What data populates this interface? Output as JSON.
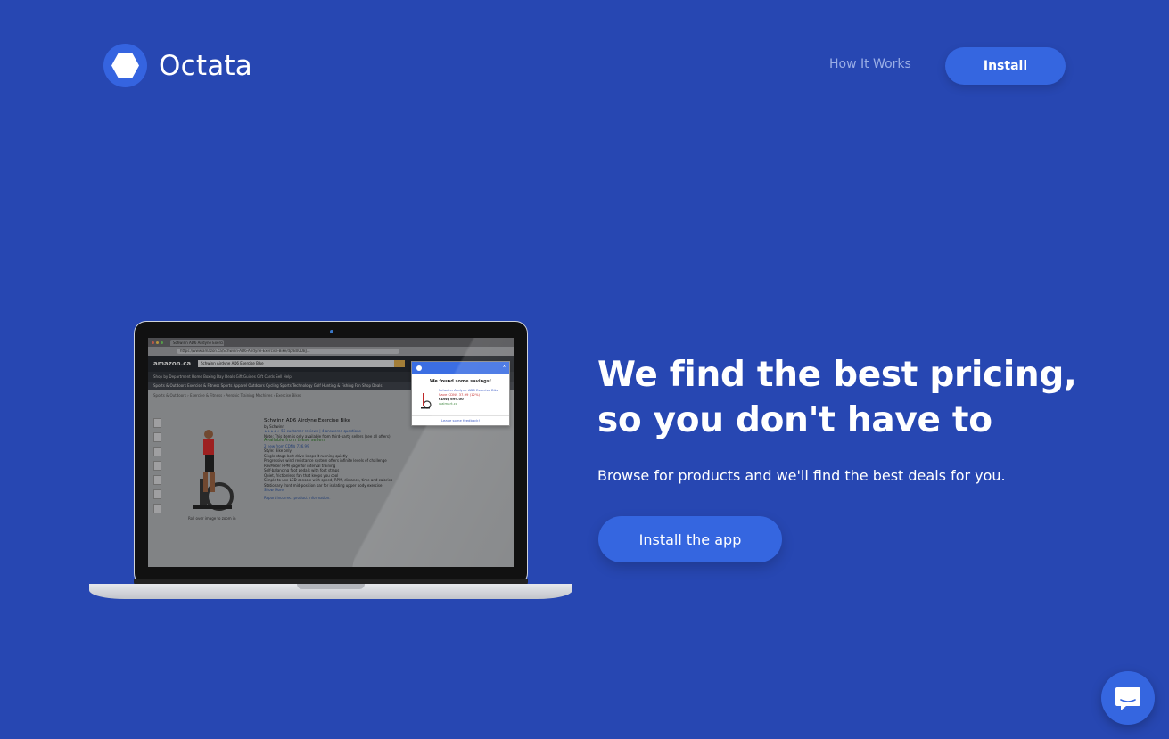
{
  "header": {
    "brand": "Octata",
    "nav_how_it_works": "How It Works",
    "install_label": "Install"
  },
  "hero": {
    "headline_line1": "We find the best pricing,",
    "headline_line2": "so you don't have to",
    "subtext": "Browse for products and we'll find the best deals for you.",
    "cta_label": "Install the app"
  },
  "screenshot": {
    "tab_title": "Schwinn AD6 Airdyne Exerci...",
    "address": "https://www.amazon.ca/Schwinn-AD6-Airdyne-Exercise-Bike/dp/B00DBJ...",
    "store_logo": "amazon.ca",
    "search_text": "Schwinn Airdyne AD6 Exercise Bike",
    "sub_nav": "Shop by Department    Home   Boxing Day Deals   Gift Guides   Gift Cards   Sell   Help",
    "categories": "Sports & Outdoors   Exercise & Fitness   Sports Apparel   Outdoors   Cycling   Sports Technology   Golf   Hunting & Fishing   Fan Shop   Deals",
    "breadcrumb": "Sports & Outdoors › Exercise & Fitness › Aerobic Training Machines › Exercise Bikes",
    "product_title": "Schwinn AD6 Airdyne Exercise Bike",
    "product_by": "by Schwinn",
    "product_reviews": "★★★★☆  56 customer reviews | 4 answered questions",
    "product_note": "Note: This item is only available from third-party sellers (see all offers).",
    "available_label": "Available from these sellers",
    "price_line": "2 new from CDN$ 736.99",
    "style_line": "Style: Bike only",
    "bullets": [
      "Single-stage belt drive keeps it running quietly",
      "Progressive wind resistance system offers infinite levels of challenge",
      "RevMeter RPM gage for interval training",
      "Self-balancing foot pedals with foot straps",
      "Quiet, frictionless fan that keeps you cool",
      "Simple to use LCD console with speed, RPM, distance, time and calories",
      "Stationary front mid-position bar for isolating upper body exercise",
      "Show More"
    ],
    "roll_over": "Roll over image to zoom in",
    "report_line": "Report incorrect product information.",
    "popup": {
      "close": "x",
      "title": "We found some savings!",
      "item_name": "Schwinn Airdyne AD6 Exercise Bike",
      "item_save": "Save CDN$ 37.99 (12%)",
      "item_price": "CDN$ 699.00",
      "item_store": "walmart.ca",
      "feedback": "Leave some feedback!"
    }
  },
  "colors": {
    "background": "#2747b2",
    "accent": "#3566e0",
    "nav_link": "#9aaee6"
  },
  "icons": {
    "logo": "hexagon-icon",
    "chat": "chat-bubble-icon"
  }
}
